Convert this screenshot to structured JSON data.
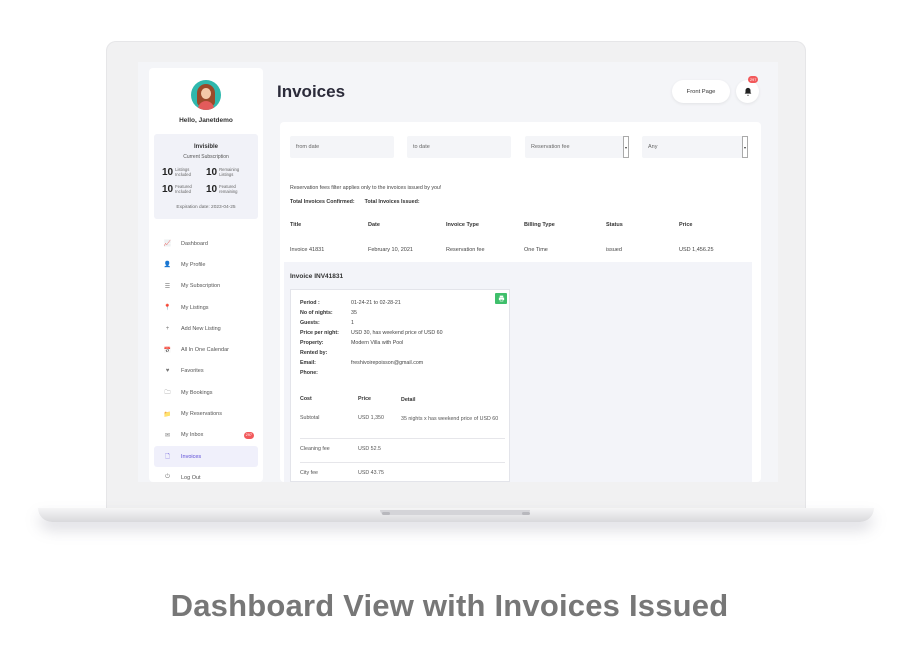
{
  "header": {
    "title": "Invoices",
    "front_page_label": "Front Page",
    "notification_count": "297"
  },
  "profile": {
    "greeting": "Hello, Janetdemo"
  },
  "subscription": {
    "name": "Invisible",
    "label": "Current Subscription",
    "stats": [
      {
        "num": "10",
        "label": "Listings Included"
      },
      {
        "num": "10",
        "label": "Remaining Listings"
      },
      {
        "num": "10",
        "label": "Featured Included"
      },
      {
        "num": "10",
        "label": "Featured remaining"
      }
    ],
    "expiry": "Expiration date: 2023-04-25"
  },
  "sidebar": {
    "items": [
      {
        "icon": "📈",
        "label": "Dashboard"
      },
      {
        "icon": "👤",
        "label": "My Profile"
      },
      {
        "icon": "☰",
        "label": "My Subscription"
      },
      {
        "icon": "📍",
        "label": "My Listings"
      },
      {
        "icon": "+",
        "label": "Add New Listing"
      },
      {
        "icon": "📅",
        "label": "All In One Calendar"
      },
      {
        "icon": "♥",
        "label": "Favorites"
      },
      {
        "icon": "🗀",
        "label": "My Bookings"
      },
      {
        "icon": "📁",
        "label": "My Reservations"
      },
      {
        "icon": "✉",
        "label": "My Inbox",
        "badge": "297"
      },
      {
        "icon": "🗋",
        "label": "Invoices"
      },
      {
        "icon": "⏻",
        "label": "Log Out"
      }
    ]
  },
  "filters": {
    "from_placeholder": "from date",
    "to_placeholder": "to date",
    "type_value": "Reservation fee",
    "status_value": "Any"
  },
  "summary": {
    "note": "Reservation fees filter applies only to the invoices issued by you!",
    "confirmed_label": "Total Invoices Confirmed:",
    "issued_label": "Total Invoices Issued:"
  },
  "table": {
    "headers": [
      "Title",
      "Date",
      "Invoice Type",
      "Billing Type",
      "Status",
      "Price"
    ],
    "rows": [
      [
        "Invoice 41831",
        "February 10, 2021",
        "Reservation fee",
        "One Time",
        "issued",
        "USD 1,456.25"
      ]
    ]
  },
  "invoice": {
    "title": "Invoice INV41831",
    "details": [
      {
        "k": "Period :",
        "v": "01-24-21 to 02-28-21"
      },
      {
        "k": "No of nights:",
        "v": "35"
      },
      {
        "k": "Guests:",
        "v": "1"
      },
      {
        "k": "Price per night:",
        "v": "USD 30, has weekend price of USD 60"
      },
      {
        "k": "Property:",
        "v": "Modern Villa with Pool"
      },
      {
        "k": "Rented by:",
        "v": ""
      },
      {
        "k": "Email:",
        "v": "freshivoirepoisson@gmail.com"
      },
      {
        "k": "Phone:",
        "v": ""
      }
    ],
    "cost_headers": [
      "Cost",
      "Price",
      "Detail"
    ],
    "cost_rows": [
      [
        "Subtotal",
        "USD 1,350",
        "35 nights x has weekend price of USD 60"
      ],
      [
        "Cleaning fee",
        "USD 52.5",
        ""
      ],
      [
        "City fee",
        "USD 43.75",
        ""
      ]
    ]
  },
  "caption": "Dashboard View with Invoices Issued"
}
